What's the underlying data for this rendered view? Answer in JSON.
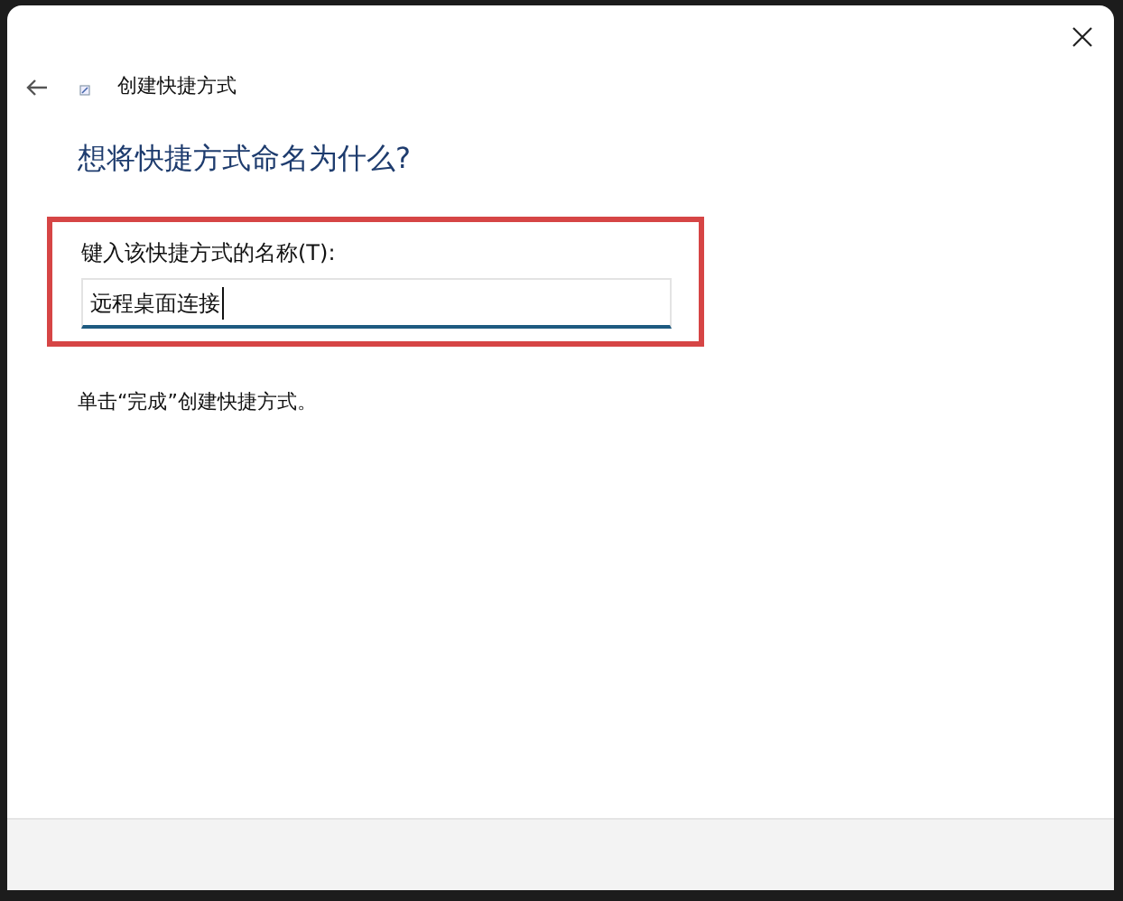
{
  "window": {
    "title": "创建快捷方式"
  },
  "heading": "想将快捷方式命名为什么?",
  "name_field": {
    "label": "键入该快捷方式的名称(T):",
    "value": "远程桌面连接",
    "focused": true,
    "highlighted": true
  },
  "instruction": "单击“完成”创建快捷方式。"
}
